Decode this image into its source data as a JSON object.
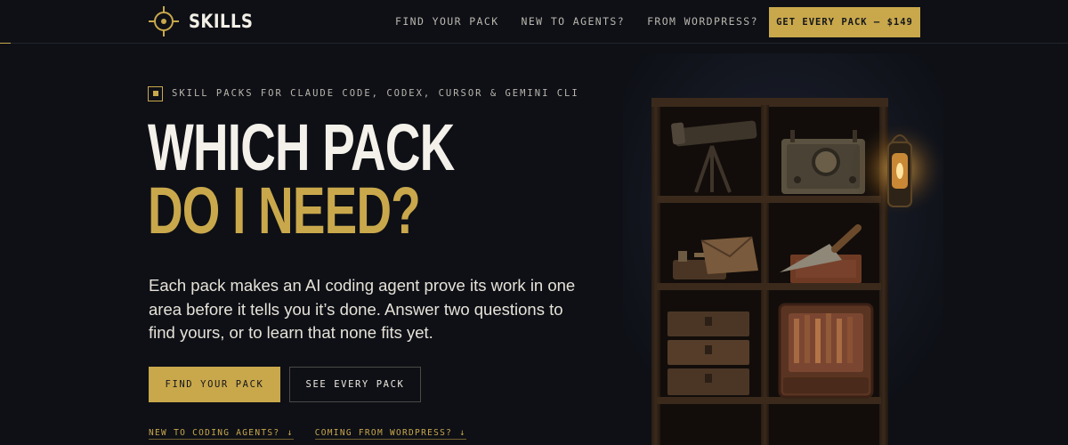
{
  "brand": {
    "name": "SKILLS",
    "logo_icon": "crosshair-icon"
  },
  "nav": {
    "links": [
      {
        "label": "FIND YOUR PACK"
      },
      {
        "label": "NEW TO AGENTS?"
      },
      {
        "label": "FROM WORDPRESS?"
      }
    ],
    "cta_label": "GET EVERY PACK — $149"
  },
  "hero": {
    "eyebrow": "SKILL PACKS FOR CLAUDE CODE, CODEX, CURSOR & GEMINI CLI",
    "eyebrow_icon": "square-bullet-icon",
    "headline_line1": "WHICH PACK",
    "headline_line2": "DO I NEED?",
    "lede": "Each pack makes an AI coding agent prove its work in one area before it tells you it’s done. Answer two questions to find yours, or to learn that none fits yet.",
    "primary_button": "FIND YOUR PACK",
    "secondary_button": "SEE EVERY PACK",
    "sublinks": [
      {
        "label": "NEW TO CODING AGENTS?",
        "icon": "arrow-down-icon",
        "glyph": "↓"
      },
      {
        "label": "COMING FROM WORDPRESS?",
        "icon": "arrow-down-icon",
        "glyph": "↓"
      }
    ]
  },
  "illustration": {
    "icon": "shelf-of-tools-illustration"
  },
  "colors": {
    "background": "#0e1016",
    "accent": "#c9a84c",
    "text": "#ece8df",
    "muted": "#b9b6ad"
  }
}
